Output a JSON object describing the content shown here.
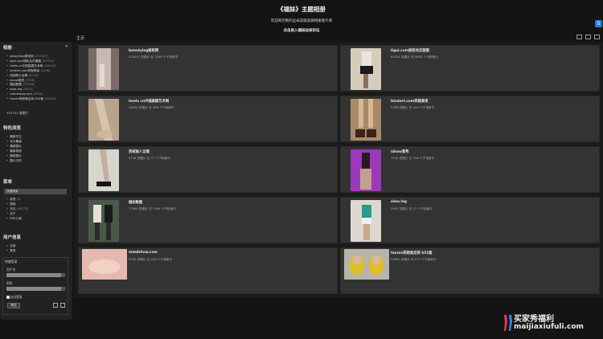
{
  "header": {
    "title": "《福妹》主题相册",
    "subtitle": "欢迎来到我的丝袜美腿美脚相册图片库",
    "enter_link": "点击进入福妹丝袜论坛"
  },
  "sidebar": {
    "albums_title": "相册",
    "albums": [
      {
        "name": "beautyleg丽柜网",
        "count": "[523007]"
      },
      {
        "name": "ligui.com丽柜会员套图",
        "count": "[63434]"
      },
      {
        "name": "heels cn中国高跟艺术网",
        "count": "[48648]"
      },
      {
        "name": "bindart.com邦妮美束",
        "count": "[5268]"
      },
      {
        "name": "西域丽人全辑",
        "count": "[6738]"
      },
      {
        "name": "ishow爱秀",
        "count": "[7028]"
      },
      {
        "name": "据如数图",
        "count": "[27684]"
      },
      {
        "name": "siwa.leg",
        "count": "[2943]"
      },
      {
        "name": "mmdshow.com",
        "count": "[6550]"
      },
      {
        "name": "fannie菲妮美足网 652套",
        "count": "[30860]"
      }
    ],
    "albums_total": "337731 张图片",
    "features_title": "特色浏览",
    "features": [
      "最新关注",
      "评分最高",
      "最新图片",
      "最新相册",
      "随机图片",
      "图片日历"
    ],
    "menu_title": "菜单",
    "menu_bar": "快速搜索",
    "menu": [
      {
        "name": "标签",
        "count": "(5)"
      },
      {
        "name": "搜索",
        "count": ""
      },
      {
        "name": "评论",
        "count": "(46275)"
      },
      {
        "name": "关于",
        "count": ""
      },
      {
        "name": "RSS订阅",
        "count": ""
      }
    ],
    "user_title": "用户信息",
    "user_links": [
      "注册",
      "登录"
    ],
    "login": {
      "title": "快速登录",
      "username_label": "用户名",
      "password_label": "密码",
      "remember_label": "自动登录",
      "submit_label": "提交"
    }
  },
  "main": {
    "title": "主页",
    "cards": [
      {
        "name": "beautyleg丽柜网",
        "info": "523007 张图片 在 2286 个子相册中"
      },
      {
        "name": "ligui.com丽柜会员套图",
        "info": "63434 张图片 在 9600 个子相册中"
      },
      {
        "name": "heels cn中国高跟艺术网",
        "info": "48648 张图片 在 668 个子相册中"
      },
      {
        "name": "bindart.com邦妮美束",
        "info": "5268 张图片 在 249 个子相册中"
      },
      {
        "name": "西域丽人全辑",
        "info": "6738 张图片 在 77 个子相册中"
      },
      {
        "name": "ishow爱秀",
        "info": "7028 张图片 在 206 个子相册中"
      },
      {
        "name": "据如数图",
        "info": "27684 张图片 在 2364 个子相册中"
      },
      {
        "name": "siwa.leg",
        "info": "2943 张图片 在 37 个子相册中"
      },
      {
        "name": "mmdshow.com",
        "info": "6550 张图片 在 250 个子相册中"
      },
      {
        "name": "fannie菲妮美足网 652套",
        "info": "30860 张图片 在 672 个子相册中"
      }
    ]
  },
  "watermark": {
    "line1": "买家秀福利",
    "line2": "maijiaxiufuli.com"
  }
}
